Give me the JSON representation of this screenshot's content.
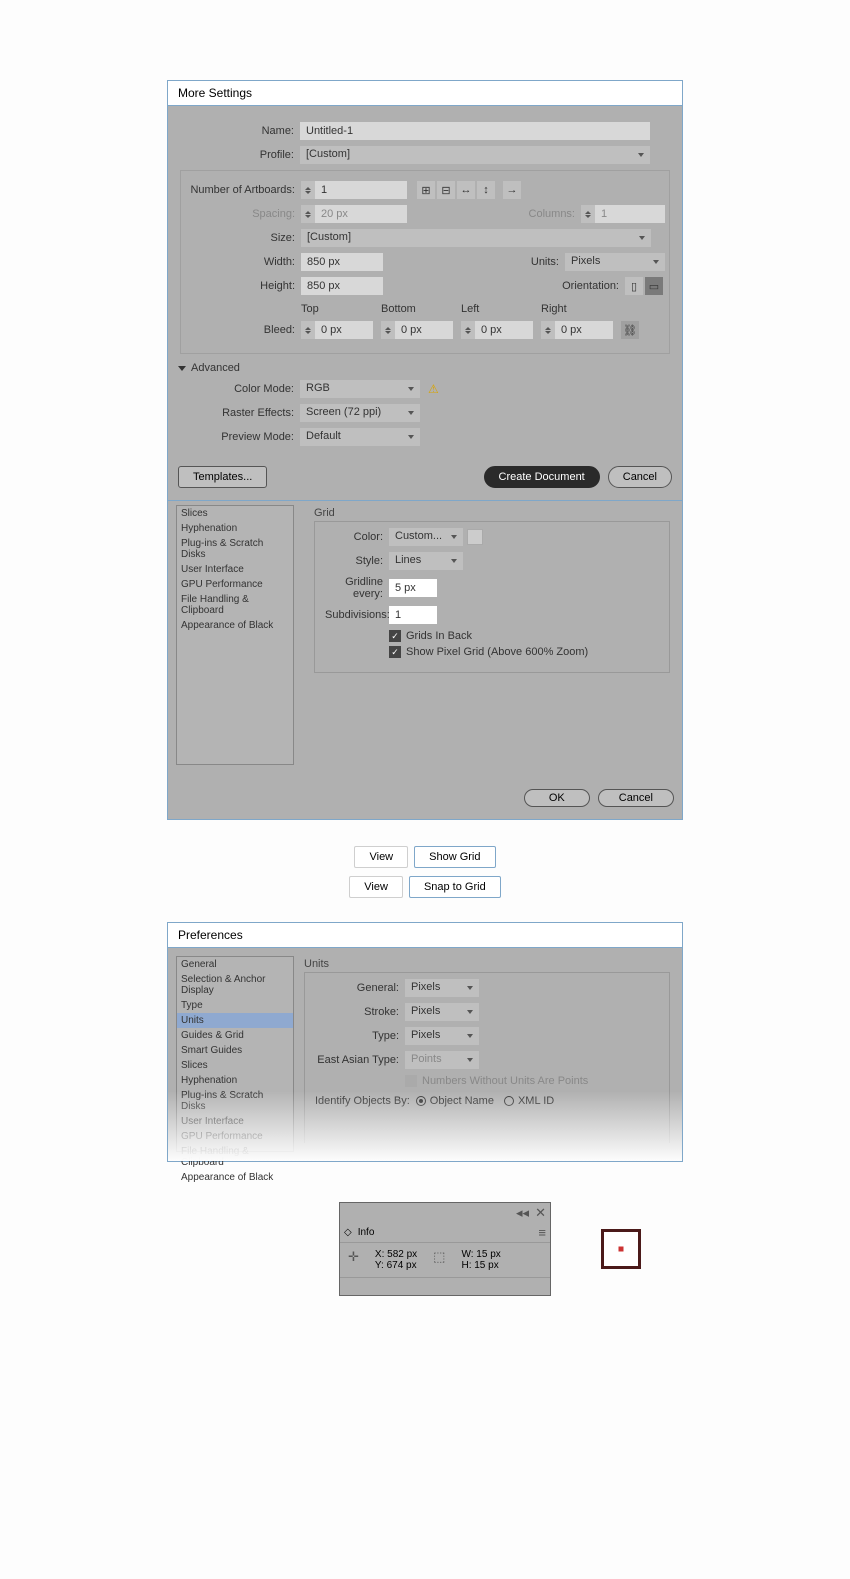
{
  "dialog1": {
    "title": "More Settings",
    "name_lbl": "Name:",
    "name_val": "Untitled-1",
    "profile_lbl": "Profile:",
    "profile_val": "[Custom]",
    "artboards_lbl": "Number of Artboards:",
    "artboards_val": "1",
    "spacing_lbl": "Spacing:",
    "spacing_val": "20 px",
    "columns_lbl": "Columns:",
    "columns_val": "1",
    "size_lbl": "Size:",
    "size_val": "[Custom]",
    "width_lbl": "Width:",
    "width_val": "850 px",
    "units_lbl": "Units:",
    "units_val": "Pixels",
    "height_lbl": "Height:",
    "height_val": "850 px",
    "orient_lbl": "Orientation:",
    "bleed_lbl": "Bleed:",
    "top": "Top",
    "bottom": "Bottom",
    "left": "Left",
    "right": "Right",
    "bleed_val": "0 px",
    "advanced": "Advanced",
    "colormode_lbl": "Color Mode:",
    "colormode_val": "RGB",
    "raster_lbl": "Raster Effects:",
    "raster_val": "Screen (72 ppi)",
    "preview_lbl": "Preview Mode:",
    "preview_val": "Default",
    "templates": "Templates...",
    "create": "Create Document",
    "cancel": "Cancel"
  },
  "prefs1": {
    "sidebar": [
      "Slices",
      "Hyphenation",
      "Plug-ins & Scratch Disks",
      "User Interface",
      "GPU Performance",
      "File Handling & Clipboard",
      "Appearance of Black"
    ],
    "panel_title": "Grid",
    "color_lbl": "Color:",
    "color_val": "Custom...",
    "style_lbl": "Style:",
    "style_val": "Lines",
    "gridline_lbl": "Gridline every:",
    "gridline_val": "5 px",
    "subdiv_lbl": "Subdivisions:",
    "subdiv_val": "1",
    "grids_back": "Grids In Back",
    "show_pixel": "Show Pixel Grid (Above 600% Zoom)",
    "ok": "OK",
    "cancel": "Cancel"
  },
  "menu": {
    "view": "View",
    "show_grid": "Show Grid",
    "snap_grid": "Snap to Grid"
  },
  "prefs2": {
    "title": "Preferences",
    "sidebar": [
      "General",
      "Selection & Anchor Display",
      "Type",
      "Units",
      "Guides & Grid",
      "Smart Guides",
      "Slices",
      "Hyphenation",
      "Plug-ins & Scratch Disks",
      "User Interface",
      "GPU Performance",
      "File Handling & Clipboard",
      "Appearance of Black"
    ],
    "selected": 3,
    "panel_title": "Units",
    "general_lbl": "General:",
    "stroke_lbl": "Stroke:",
    "type_lbl": "Type:",
    "east_lbl": "East Asian Type:",
    "val_pixels": "Pixels",
    "val_points": "Points",
    "num_without": "Numbers Without Units Are Points",
    "identify": "Identify Objects By:",
    "obj_name": "Object Name",
    "xml_id": "XML ID"
  },
  "info": {
    "title": "Info",
    "x_lbl": "X:",
    "x_val": "582 px",
    "y_lbl": "Y:",
    "y_val": "674 px",
    "w_lbl": "W:",
    "w_val": "15 px",
    "h_lbl": "H:",
    "h_val": "15 px"
  }
}
